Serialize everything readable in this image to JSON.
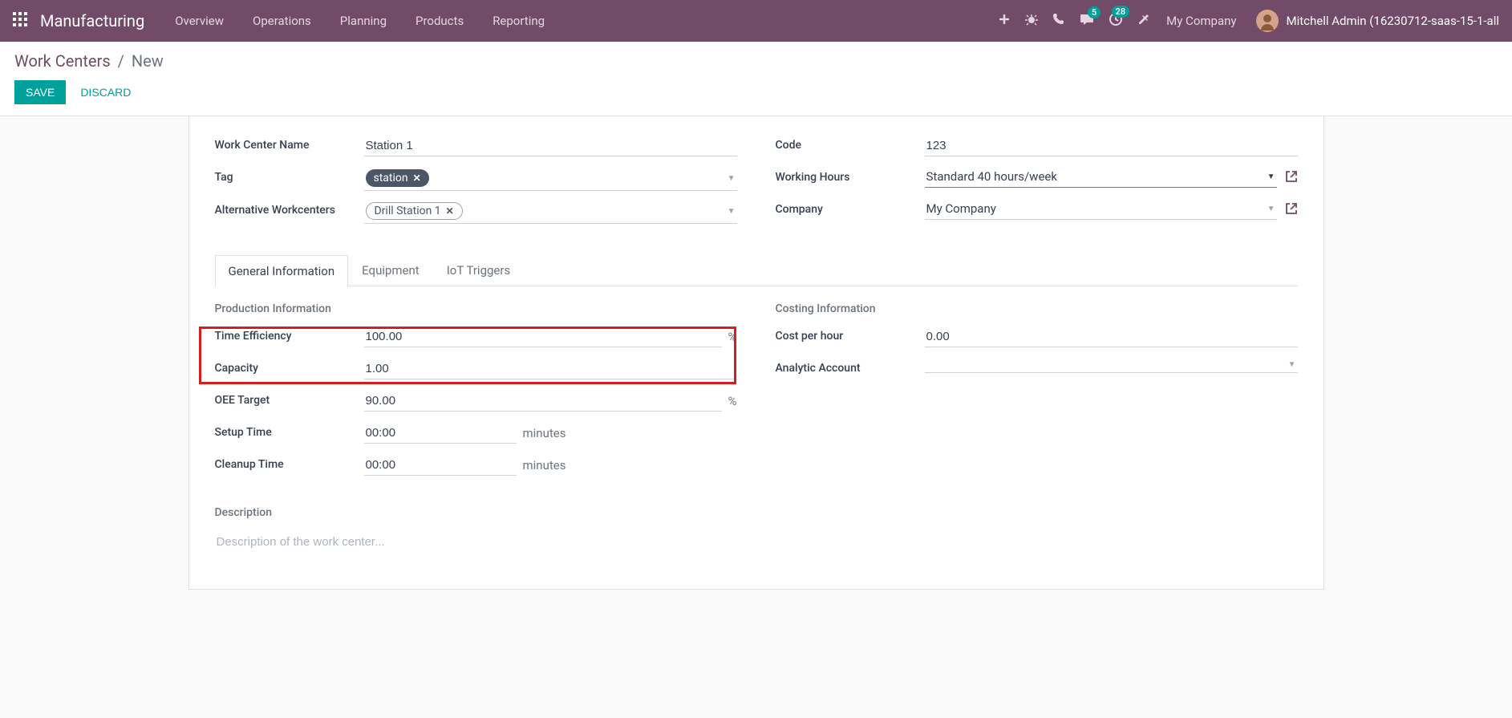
{
  "navbar": {
    "app_title": "Manufacturing",
    "menu": [
      "Overview",
      "Operations",
      "Planning",
      "Products",
      "Reporting"
    ],
    "msg_badge": "5",
    "activity_badge": "28",
    "company": "My Company",
    "user": "Mitchell Admin (16230712-saas-15-1-all"
  },
  "breadcrumb": {
    "parent": "Work Centers",
    "current": "New"
  },
  "buttons": {
    "save": "SAVE",
    "discard": "DISCARD"
  },
  "form": {
    "left": {
      "name_label": "Work Center Name",
      "name_value": "Station 1",
      "tag_label": "Tag",
      "tag_value": "station",
      "alt_label": "Alternative Workcenters",
      "alt_value": "Drill Station 1"
    },
    "right": {
      "code_label": "Code",
      "code_value": "123",
      "hours_label": "Working Hours",
      "hours_value": "Standard 40 hours/week",
      "company_label": "Company",
      "company_value": "My Company"
    }
  },
  "tabs": [
    "General Information",
    "Equipment",
    "IoT Triggers"
  ],
  "sections": {
    "prod_title": "Production Information",
    "cost_title": "Costing Information",
    "desc_title": "Description",
    "time_eff_label": "Time Efficiency",
    "time_eff_value": "100.00",
    "capacity_label": "Capacity",
    "capacity_value": "1.00",
    "oee_label": "OEE Target",
    "oee_value": "90.00",
    "setup_label": "Setup Time",
    "setup_value": "00:00",
    "cleanup_label": "Cleanup Time",
    "cleanup_value": "00:00",
    "cost_hour_label": "Cost per hour",
    "cost_hour_value": "0.00",
    "analytic_label": "Analytic Account",
    "analytic_value": "",
    "unit_pct": "%",
    "unit_min": "minutes",
    "desc_placeholder": "Description of the work center..."
  }
}
